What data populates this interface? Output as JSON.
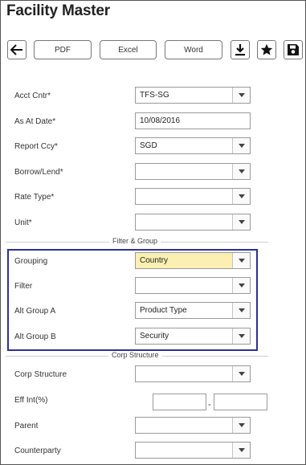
{
  "page": {
    "title": "Facility Master"
  },
  "toolbar": {
    "back_icon": "arrow-left-icon",
    "pdf_label": "PDF",
    "excel_label": "Excel",
    "word_label": "Word",
    "download_icon": "download-icon",
    "favorite_icon": "star-icon",
    "save_icon": "floppy-disk-icon"
  },
  "form": {
    "acct_cntr": {
      "label": "Acct Cntr*",
      "value": "TFS-SG"
    },
    "as_at_date": {
      "label": "As At Date*",
      "value": "10/08/2016"
    },
    "report_ccy": {
      "label": "Report Ccy*",
      "value": "SGD"
    },
    "borrow_lend": {
      "label": "Borrow/Lend*",
      "value": ""
    },
    "rate_type": {
      "label": "Rate Type*",
      "value": ""
    },
    "unit": {
      "label": "Unit*",
      "value": ""
    }
  },
  "filter_group": {
    "section_title": "Filter & Group",
    "grouping": {
      "label": "Grouping",
      "value": "Country"
    },
    "filter": {
      "label": "Filter",
      "value": ""
    },
    "alt_group_a": {
      "label": "Alt Group A",
      "value": "Product Type"
    },
    "alt_group_b": {
      "label": "Alt Group B",
      "value": "Security"
    }
  },
  "corp_structure": {
    "section_title": "Corp Structure",
    "corp_structure": {
      "label": "Corp Structure",
      "value": ""
    },
    "eff_int": {
      "label": "Eff Int(%)",
      "from": "",
      "separator": "-",
      "to": ""
    },
    "parent": {
      "label": "Parent",
      "value": ""
    },
    "counterparty": {
      "label": "Counterparty",
      "value": ""
    }
  },
  "colors": {
    "highlight_bg": "#fbf0b2",
    "group_border": "#2e3191"
  }
}
